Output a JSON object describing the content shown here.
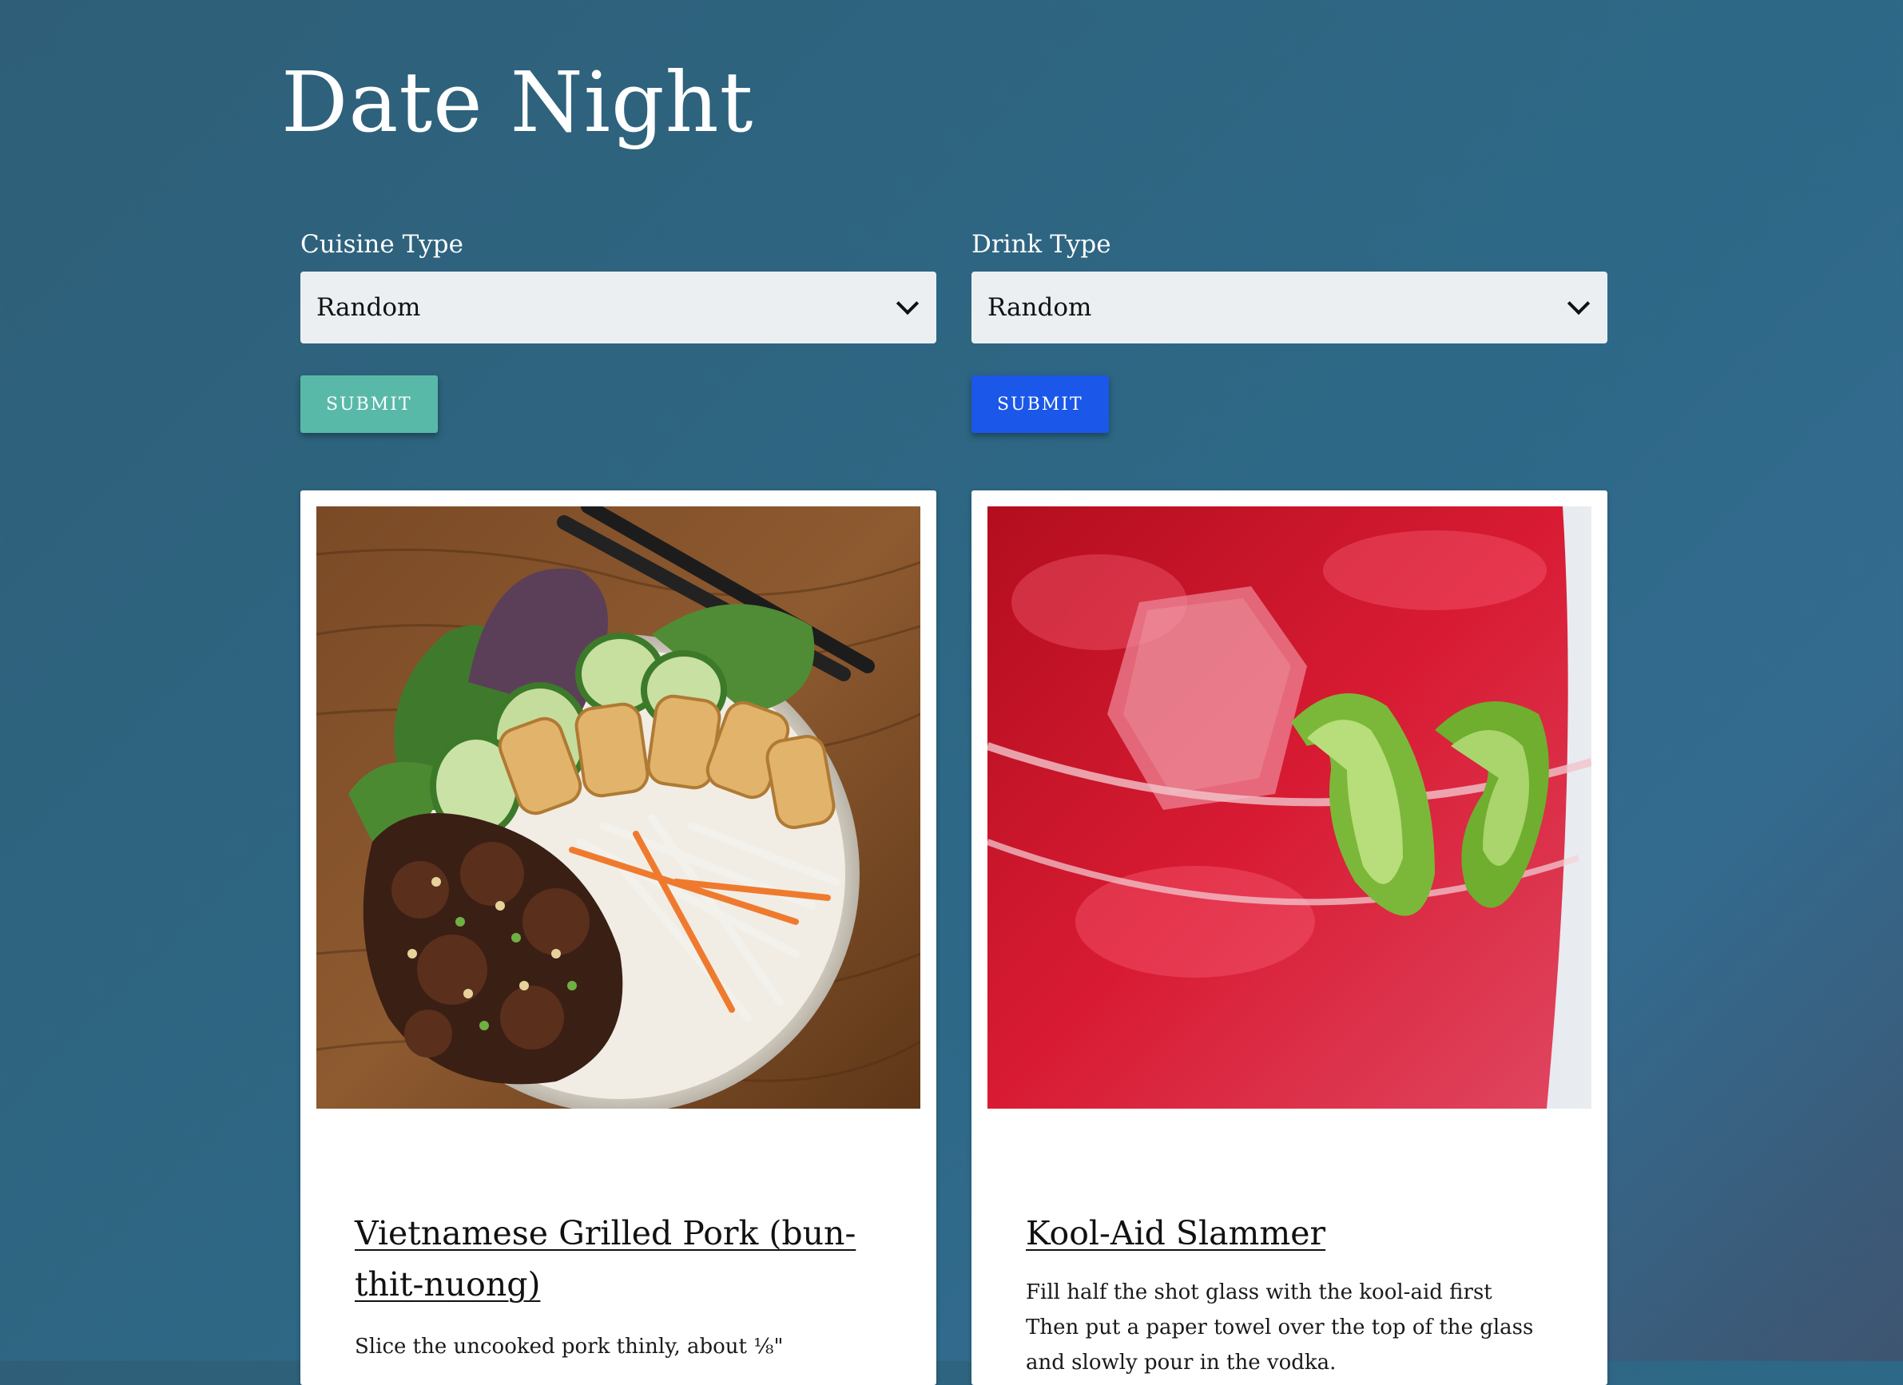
{
  "page": {
    "title": "Date Night"
  },
  "cuisine": {
    "label": "Cuisine Type",
    "selected": "Random",
    "submit_label": "SUBMIT"
  },
  "drink": {
    "label": "Drink Type",
    "selected": "Random",
    "submit_label": "SUBMIT"
  },
  "food_card": {
    "title": "Vietnamese Grilled Pork (bun-thit-nuong)",
    "instructions": [
      "Slice the uncooked pork thinly, about ⅛\""
    ]
  },
  "drink_card": {
    "title": "Kool-Aid Slammer",
    "instructions": [
      "Fill half the shot glass with the kool-aid first",
      "Then put a paper towel over the top of the glass and slowly pour in the vodka."
    ]
  },
  "colors": {
    "cuisine_submit": "#59b9a9",
    "drink_submit": "#1b57e8",
    "select_bg": "#ebeff2"
  },
  "icons": {
    "select_arrow": "chevron-down-icon"
  }
}
